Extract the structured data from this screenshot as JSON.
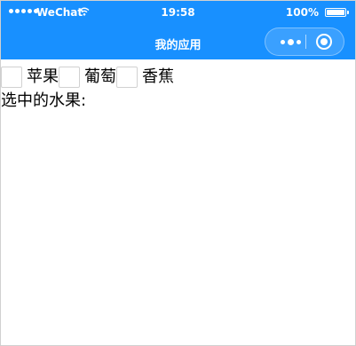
{
  "statusbar": {
    "carrier": "WeChat",
    "time": "19:58",
    "battery_pct": "100%"
  },
  "navbar": {
    "title": "我的应用"
  },
  "fruits": [
    {
      "label": "苹果",
      "checked": false
    },
    {
      "label": "葡萄",
      "checked": false
    },
    {
      "label": "香蕉",
      "checked": false
    }
  ],
  "selected": {
    "label": "选中的水果:",
    "value": ""
  },
  "colors": {
    "accent": "#1890ff"
  },
  "icons": {
    "signal": "signal-icon",
    "wifi": "wifi-icon",
    "battery": "battery-icon",
    "more": "more-icon",
    "close": "close-icon"
  }
}
